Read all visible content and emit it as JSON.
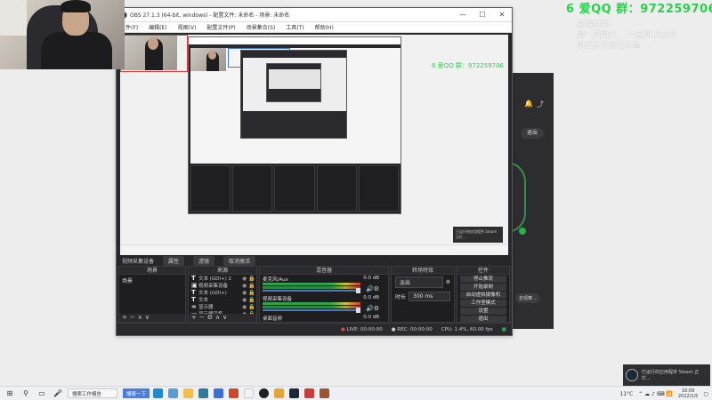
{
  "overlay": {
    "qq": "6 爱QQ 群：972259706",
    "notes": [
      "直播时间：",
      "周一到周六，14点到18点半",
      "周日及节假日休息"
    ]
  },
  "obs": {
    "title": "OBS 27.1.3 (64-bit, windows) - 配置文件: 未命名 - 场景: 未命名",
    "window_controls": [
      "—",
      "☐",
      "✕"
    ],
    "menu": [
      "文件(F)",
      "编辑(E)",
      "视图(V)",
      "配置文件(P)",
      "场景集合(S)",
      "工具(T)",
      "帮助(H)"
    ],
    "preview_green": "6 爱QQ 群：972259706",
    "source_toolbar": {
      "current": "视频采集设备",
      "properties": "属性",
      "filters": "滤镜",
      "deactivate": "取消激活"
    },
    "docks": {
      "scenes": {
        "title": "场景",
        "items": [
          "场景"
        ]
      },
      "sources": {
        "title": "来源",
        "items": [
          {
            "icon": "T",
            "name": "文本 (GDI+) 2"
          },
          {
            "icon": "▣",
            "name": "视频采集设备"
          },
          {
            "icon": "T",
            "name": "文本 (GDI+)"
          },
          {
            "icon": "T",
            "name": "文本"
          },
          {
            "icon": "∞",
            "name": "显示器"
          },
          {
            "icon": "▭",
            "name": "显示器采集"
          }
        ]
      },
      "mixer": {
        "title": "混音器",
        "channels": [
          {
            "name": "麦克风/Aux",
            "db": "0.0 dB"
          },
          {
            "name": "视频采集设备",
            "db": "0.0 dB"
          },
          {
            "name": "桌面音频",
            "db": "0.0 dB"
          }
        ]
      },
      "transitions": {
        "title": "转场特效",
        "type": "淡出",
        "duration_label": "时长",
        "duration": "300 ms"
      },
      "controls": {
        "title": "控件",
        "buttons": [
          "停止推流",
          "开始录制",
          "启动虚拟摄像机",
          "工作室模式",
          "设置",
          "退出"
        ]
      }
    },
    "status": {
      "live_label": "LIVE:",
      "live_time": "00:00:00",
      "rec_label": "REC:",
      "rec_time": "00:00:00",
      "cpu": "CPU: 1.4%, 60.00 fps"
    }
  },
  "dark_app": {
    "exit": "退出",
    "bottom_btn": "去观察..."
  },
  "toast": {
    "text": "已运行的应用程序 Steam 正忙..."
  },
  "taskbar": {
    "search": "搜索工作报告",
    "chip": "搜索一下",
    "temperature": "11°C",
    "time": "16:09",
    "date": "2022/1/5"
  },
  "colors": {
    "obs_bg": "#2a2a2e",
    "overlay_green": "#27d34a",
    "accent_blue": "#4a78c8",
    "desktop": "#ededed"
  }
}
